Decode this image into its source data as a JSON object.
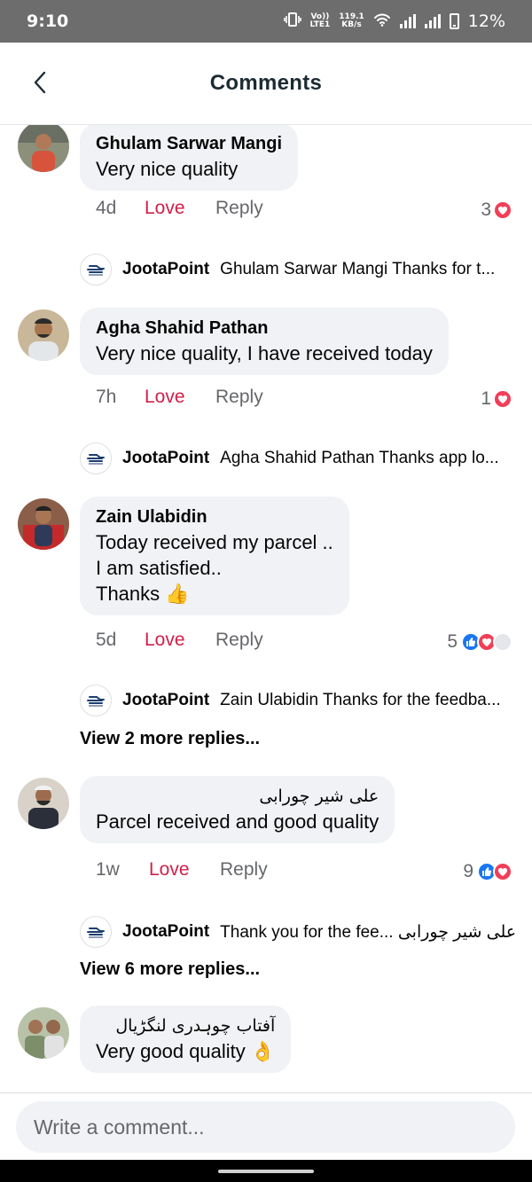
{
  "status": {
    "time": "9:10",
    "volte_top": "Vo))",
    "volte_bottom": "LTE1",
    "speed_top": "119.1",
    "speed_bottom": "KB/s",
    "battery": "12%"
  },
  "header": {
    "title": "Comments",
    "back_icon": "chevron-left-icon"
  },
  "colors": {
    "love": "#d0204a",
    "bubble": "#f0f2f5",
    "heart": "#f33e58",
    "like": "#1877f2"
  },
  "comments": [
    {
      "author": "Ghulam Sarwar Mangi",
      "text": "Very nice quality",
      "age": "4d",
      "love": "Love",
      "reply": "Reply",
      "reaction_count": "3",
      "page_reply": {
        "name": "JootaPoint",
        "text": "Ghulam Sarwar Mangi Thanks for t..."
      }
    },
    {
      "author": "Agha Shahid Pathan",
      "text": "Very nice quality, I have received today",
      "age": "7h",
      "love": "Love",
      "reply": "Reply",
      "reaction_count": "1",
      "page_reply": {
        "name": "JootaPoint",
        "text": "Agha Shahid Pathan Thanks app lo..."
      }
    },
    {
      "author": "Zain Ulabidin",
      "text_lines": [
        "Today received my parcel ..",
        "I am satisfied..",
        "Thanks 👍"
      ],
      "age": "5d",
      "love": "Love",
      "reply": "Reply",
      "reaction_count": "5",
      "page_reply": {
        "name": "JootaPoint",
        "text": "Zain Ulabidin Thanks for the feedba..."
      },
      "view_more": "View 2 more replies..."
    },
    {
      "author": "علی شیر چورابی",
      "text": "Parcel received and good quality",
      "age": "1w",
      "love": "Love",
      "reply": "Reply",
      "reaction_count": "9",
      "page_reply": {
        "name": "JootaPoint",
        "text": "Thank you for the fee... علی شیر چورابی"
      },
      "view_more": "View 6 more replies..."
    },
    {
      "author": "آفتاب چوہدری لنگڑیال",
      "text": "Very good quality 👌"
    }
  ],
  "composer": {
    "placeholder": "Write a comment..."
  }
}
